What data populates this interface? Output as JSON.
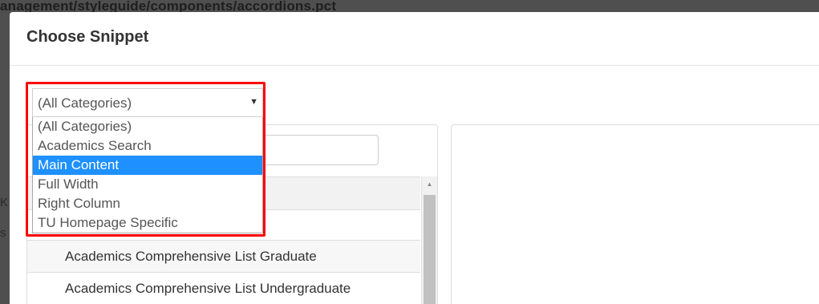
{
  "background": {
    "url_text": "anagement/styleguide/components/accordions.pct",
    "side_glyph_1": "K",
    "side_glyph_2": "s"
  },
  "modal": {
    "title": "Choose Snippet"
  },
  "category_select": {
    "value": "(All Categories)",
    "arrow_icon": "caret-down-icon",
    "options": [
      "(All Categories)",
      "Academics Search",
      "Main Content",
      "Full Width",
      "Right Column",
      "TU Homepage Specific"
    ],
    "highlighted_option": "Main Content"
  },
  "snippet_list": {
    "items": [
      "Academics Comprehensive List Graduate",
      "Academics Comprehensive List Undergraduate"
    ]
  },
  "colors": {
    "highlight_border": "#ff0000",
    "selected_option": "#1e90ff"
  }
}
